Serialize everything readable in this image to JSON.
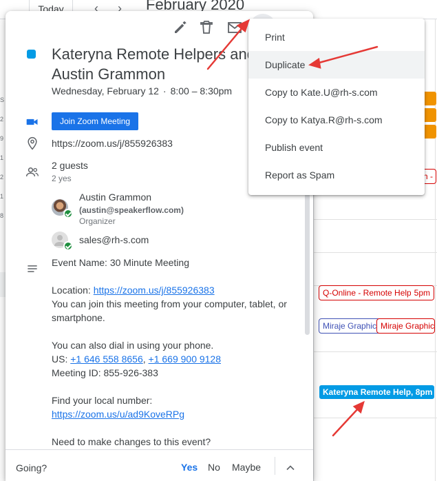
{
  "header": {
    "today_label": "Today",
    "prev_icon": "chevron-left-icon",
    "next_icon": "chevron-right-icon",
    "month_title": "February 2020"
  },
  "sidebar_letters": [
    "S",
    "2",
    "9",
    "1",
    "2",
    "1",
    "8"
  ],
  "background_events": [
    {
      "label": "h -"
    },
    {
      "label": "Q-Online - Remote Help",
      "time": "5pm"
    },
    {
      "label": "Miraje Graphic"
    },
    {
      "label": "Miraje Graphic"
    },
    {
      "label": "Kateryna Remote Help, 8pm"
    }
  ],
  "event": {
    "color": "#039be5",
    "title": "Kateryna Remote Helpers and Austin Grammon",
    "date": "Wednesday, February 12",
    "time": "8:00 – 8:30pm",
    "zoom_button": "Join Zoom Meeting",
    "location": "https://zoom.us/j/855926383",
    "guests_title": "2 guests",
    "guests_yes": "2 yes",
    "guests": [
      {
        "name": "Austin Grammon",
        "email": "(austin@speakerflow.com)",
        "role": "Organizer"
      },
      {
        "name": "sales@rh-s.com"
      }
    ],
    "description": {
      "event_name": "Event Name: 30 Minute Meeting",
      "location_label": "Location:",
      "location_link": "https://zoom.us/j/855926383",
      "join_text": "You can join this meeting from your computer, tablet, or smartphone.",
      "dial_text": "You can also dial in using your phone.",
      "us_label": "US:",
      "phone_1": "+1 646 558 8656",
      "phone_sep": ",",
      "phone_2": "+1 669 900 9128",
      "meeting_id": "Meeting ID: 855-926-383",
      "local_label": "Find your local number:",
      "local_link": "https://zoom.us/u/ad9KoveRPg",
      "changes_text": "Need to make changes to this event?"
    }
  },
  "footer": {
    "going_label": "Going?",
    "yes": "Yes",
    "no": "No",
    "maybe": "Maybe"
  },
  "menu": {
    "items": [
      {
        "label": "Print"
      },
      {
        "label": "Duplicate"
      },
      {
        "label": "Copy to Kate.U@rh-s.com"
      },
      {
        "label": "Copy to Katya.R@rh-s.com"
      },
      {
        "label": "Publish event"
      },
      {
        "label": "Report as Spam"
      }
    ]
  },
  "colors": {
    "accent": "#1a73e8",
    "event_blue": "#039be5",
    "annotation_red": "#e53935"
  }
}
